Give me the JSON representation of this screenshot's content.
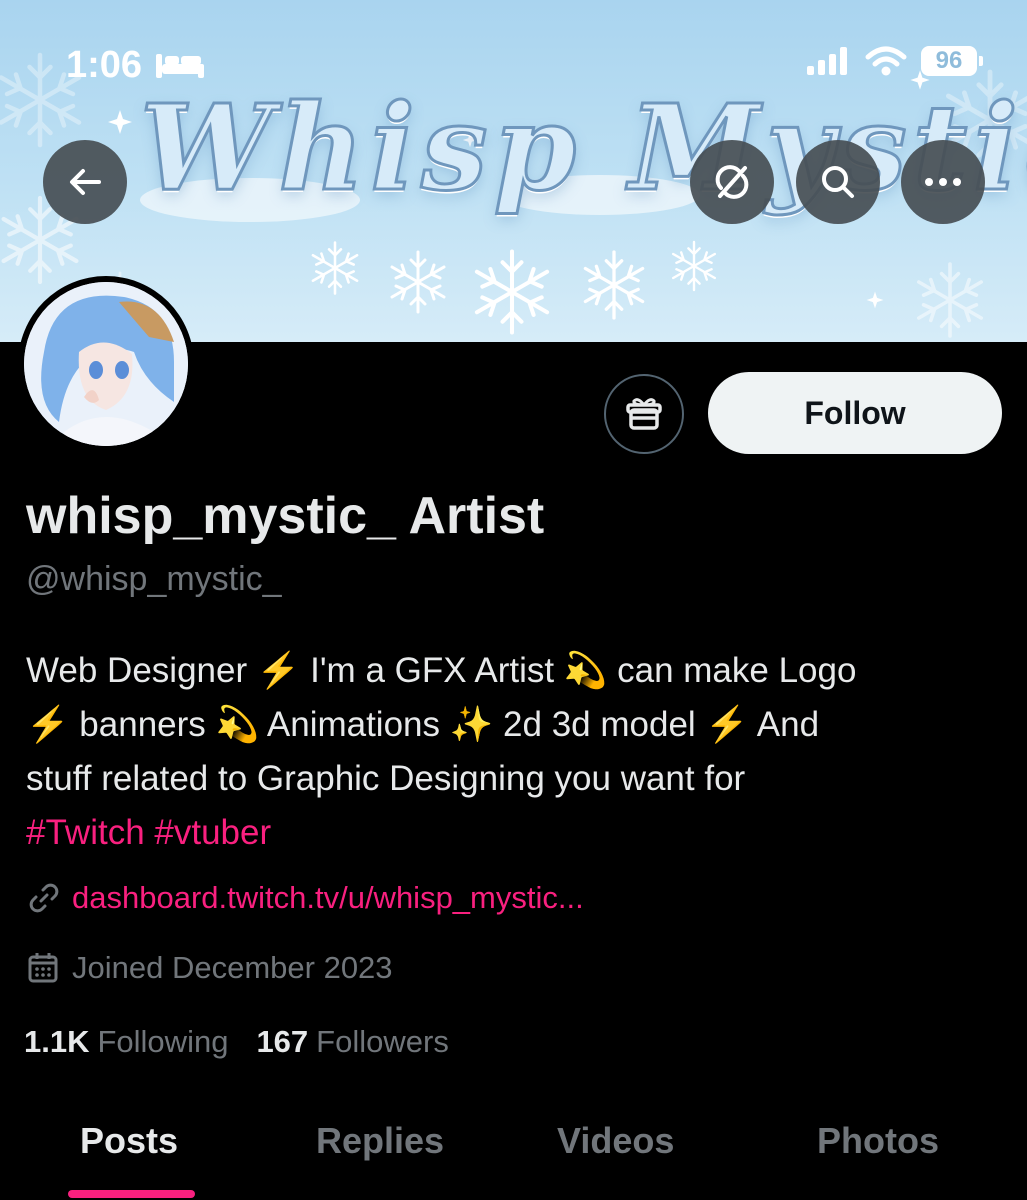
{
  "status_bar": {
    "time": "1:06",
    "battery": "96",
    "icons": [
      "bed-icon",
      "signal-icon",
      "wifi-icon",
      "battery-icon"
    ]
  },
  "banner": {
    "text": "Whisp Mystic"
  },
  "nav": {
    "icons": [
      "back-arrow-icon",
      "no-sync-icon",
      "search-icon",
      "more-icon"
    ]
  },
  "profile": {
    "display_name": "whisp_mystic_ Artist",
    "handle": "@whisp_mystic_",
    "bio_lines": [
      "Web Designer ⚡ I'm a GFX Artist 💫 can make Logo",
      "⚡ banners 💫 Animations ✨ 2d 3d model ⚡ And",
      "stuff related to Graphic Designing you want for"
    ],
    "hashtags": [
      "#Twitch",
      "#vtuber"
    ],
    "link": "dashboard.twitch.tv/u/whisp_mystic...",
    "joined": "Joined December 2023",
    "following_count": "1.1K",
    "following_label": "Following",
    "followers_count": "167",
    "followers_label": "Followers"
  },
  "actions": {
    "follow_label": "Follow"
  },
  "tabs": [
    {
      "label": "Posts",
      "active": true
    },
    {
      "label": "Replies",
      "active": false
    },
    {
      "label": "Videos",
      "active": false
    },
    {
      "label": "Photos",
      "active": false
    }
  ],
  "colors": {
    "accent": "#f9207f",
    "background": "#000000",
    "muted_text": "#71767b",
    "follow_bg": "#eff3f4"
  }
}
